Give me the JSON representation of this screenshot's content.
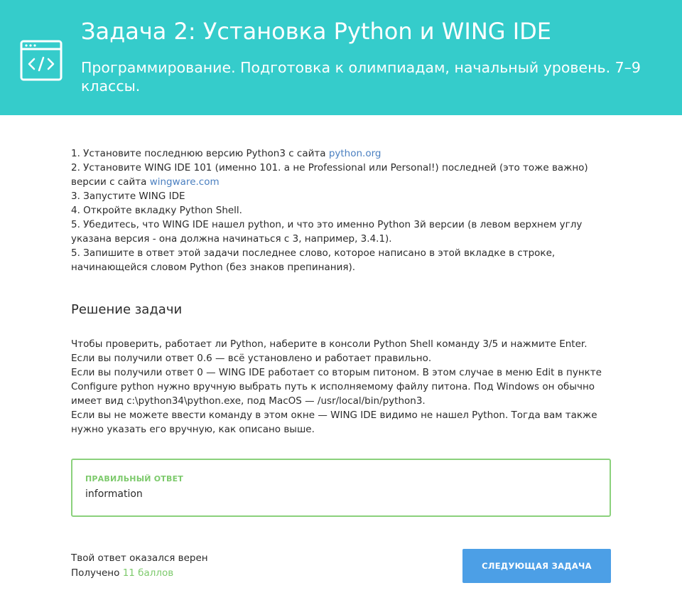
{
  "header": {
    "title": "Задача 2: Установка Python и WING IDE",
    "subtitle": "Программирование. Подготовка к олимпиадам, начальный уровень. 7–9 классы.",
    "icon": "code-window-icon"
  },
  "task": {
    "line1_text": "1. Установите последнюю версию Python3 с сайта ",
    "line1_link": "python.org",
    "line2_text": "2. Установите WING IDE 101 (именно 101. а не Professional или Personal!) последней (это тоже важно) версии с сайта ",
    "line2_link": "wingware.com",
    "line3": "3. Запустите WING IDE",
    "line4": "4. Откройте вкладку Python Shell.",
    "line5": "5. Убедитесь, что WING IDE нашел python, и что это именно Python 3й версии (в левом верхнем углу указана версия - она должна начинаться с 3, например, 3.4.1).",
    "line6": "5. Запишите в ответ этой задачи последнее слово, которое написано в этой вкладке в строке, начинающейся словом Python (без знаков препинания)."
  },
  "solution": {
    "heading": "Решение задачи",
    "p1": "Чтобы проверить, работает ли Python, наберите в консоли Python Shell команду 3/5 и нажмите Enter.",
    "p2": "Если вы получили ответ 0.6 — всё установлено и работает правильно.",
    "p3": "Если вы получили ответ 0 — WING IDE работает со вторым питоном. В этом случае  в меню Edit в пункте Configure python нужно вручную выбрать путь к исполняемому файлу питона. Под Windows он обычно имеет вид c:\\python34\\python.exe, под MacOS — /usr/local/bin/python3.",
    "p4": "Если вы не можете ввести команду в этом окне — WING IDE видимо не нашел Python. Тогда вам также нужно указать его вручную, как описано выше."
  },
  "answer": {
    "label": "ПРАВИЛЬНЫЙ ОТВЕТ",
    "value": "information"
  },
  "result": {
    "status": "Твой ответ оказался верен",
    "received_prefix": "Получено ",
    "points": "11 баллов"
  },
  "next_button": "СЛЕДУЮЩАЯ ЗАДАЧА",
  "colors": {
    "header_bg": "#35cccb",
    "accent_green": "#7dca6c",
    "button_blue": "#4c9fe6",
    "link_blue": "#4a7fc0"
  }
}
